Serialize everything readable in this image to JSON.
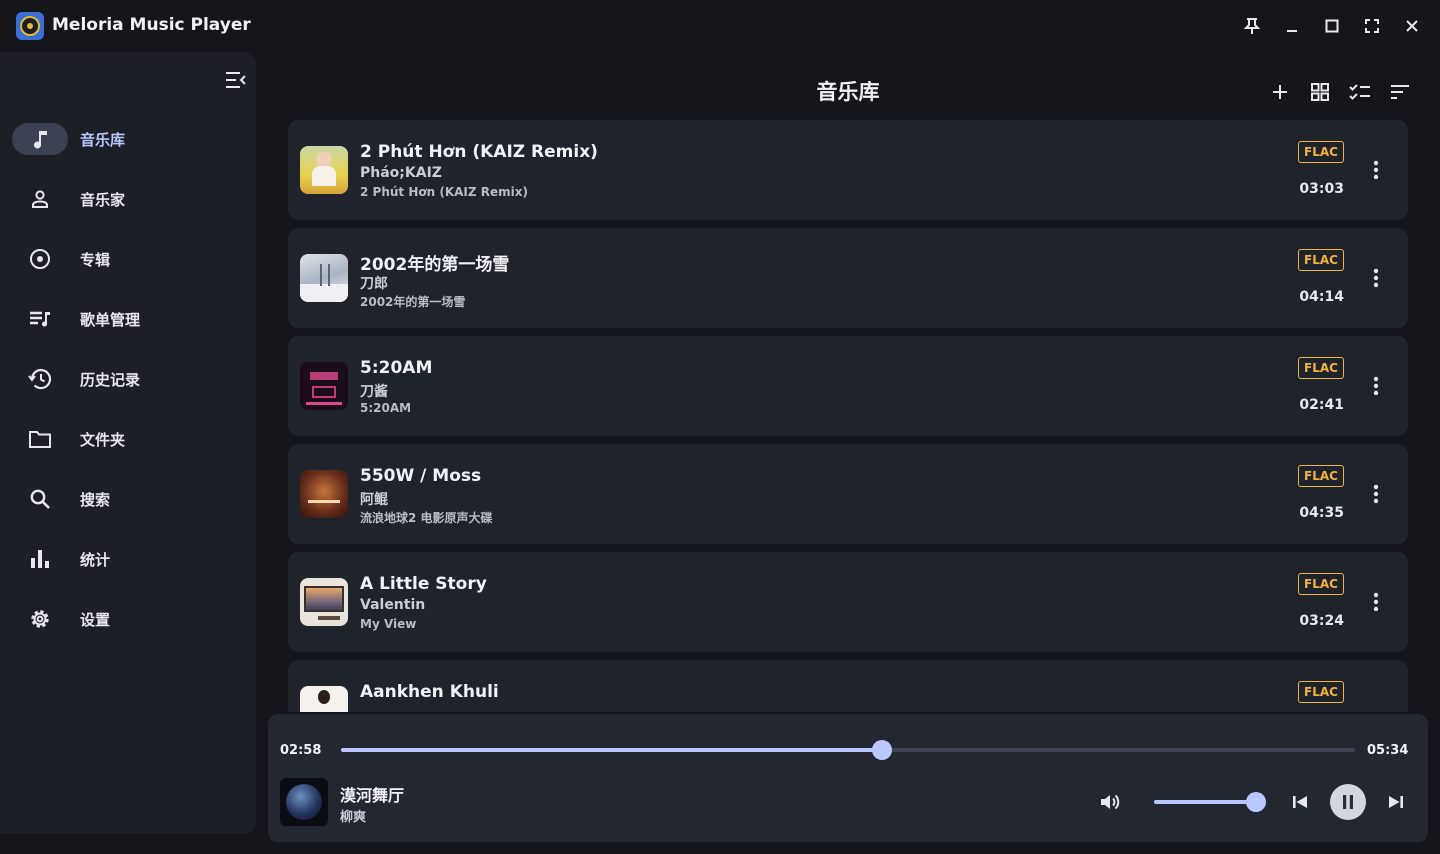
{
  "window": {
    "title": "Meloria Music Player"
  },
  "sidebar": {
    "items": [
      {
        "label": "音乐库",
        "icon": "music-note-icon",
        "active": true
      },
      {
        "label": "音乐家",
        "icon": "person-icon",
        "active": false
      },
      {
        "label": "专辑",
        "icon": "disc-icon",
        "active": false
      },
      {
        "label": "歌单管理",
        "icon": "playlist-icon",
        "active": false
      },
      {
        "label": "历史记录",
        "icon": "history-icon",
        "active": false
      },
      {
        "label": "文件夹",
        "icon": "folder-icon",
        "active": false
      },
      {
        "label": "搜索",
        "icon": "search-icon",
        "active": false
      },
      {
        "label": "统计",
        "icon": "bar-chart-icon",
        "active": false
      },
      {
        "label": "设置",
        "icon": "gear-icon",
        "active": false
      }
    ]
  },
  "main": {
    "title": "音乐库",
    "songs": [
      {
        "title": "2 Phút Hơn (KAIZ Remix)",
        "artist": "Pháo;KAIZ",
        "album": "2 Phút Hơn (KAIZ Remix)",
        "format": "FLAC",
        "duration": "03:03"
      },
      {
        "title": "2002年的第一场雪",
        "artist": "刀郎",
        "album": "2002年的第一场雪",
        "format": "FLAC",
        "duration": "04:14"
      },
      {
        "title": "5:20AM",
        "artist": "刀酱",
        "album": "5:20AM",
        "format": "FLAC",
        "duration": "02:41"
      },
      {
        "title": "550W / Moss",
        "artist": "阿鲲",
        "album": "流浪地球2 电影原声大碟",
        "format": "FLAC",
        "duration": "04:35"
      },
      {
        "title": "A Little Story",
        "artist": "Valentin",
        "album": "My View",
        "format": "FLAC",
        "duration": "03:24"
      },
      {
        "title": "Aankhen Khuli",
        "artist": "",
        "album": "",
        "format": "FLAC",
        "duration": ""
      }
    ]
  },
  "player": {
    "current_time": "02:58",
    "total_time": "05:34",
    "progress": 0.534,
    "volume": 1.0,
    "now_playing": {
      "title": "漠河舞厅",
      "artist": "柳爽"
    },
    "state": "playing"
  },
  "colors": {
    "accent": "#b9c8ff",
    "badge": "#f2b33d",
    "background": "#14161c",
    "panel": "#1c1f26"
  }
}
